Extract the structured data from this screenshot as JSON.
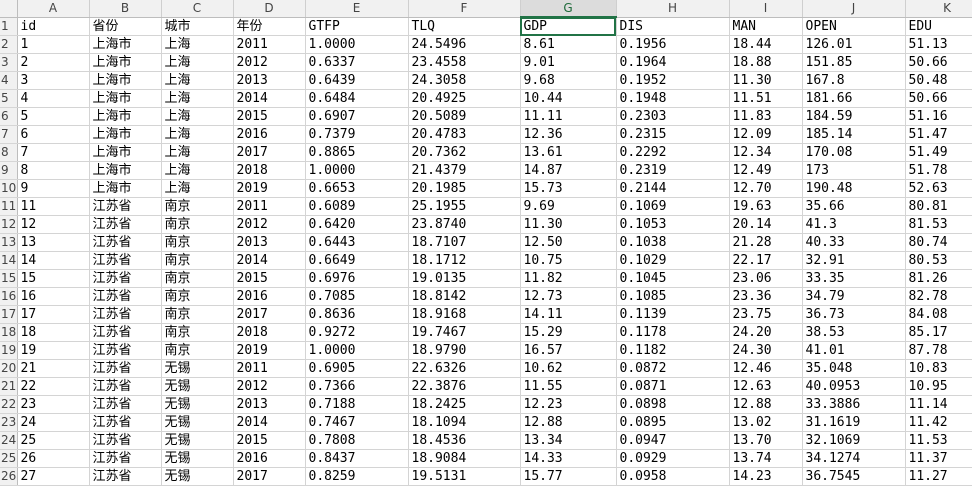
{
  "columns": [
    "A",
    "B",
    "C",
    "D",
    "E",
    "F",
    "G",
    "H",
    "I",
    "J",
    "K"
  ],
  "active_column": "G",
  "selected_cell": "G1",
  "rows": [
    {
      "n": "1",
      "cells": [
        "id",
        "省份",
        "城市",
        "年份",
        "GTFP",
        "TLQ",
        "GDP",
        "DIS",
        "MAN",
        "OPEN",
        "EDU"
      ]
    },
    {
      "n": "2",
      "cells": [
        "1",
        "上海市",
        "上海",
        "2011",
        "1.0000",
        "24.5496",
        "8.61",
        "0.1956",
        "18.44",
        "126.01",
        "51.13"
      ]
    },
    {
      "n": "3",
      "cells": [
        "2",
        "上海市",
        "上海",
        "2012",
        "0.6337",
        "23.4558",
        "9.01",
        "0.1964",
        "18.88",
        "151.85",
        "50.66"
      ]
    },
    {
      "n": "4",
      "cells": [
        "3",
        "上海市",
        "上海",
        "2013",
        "0.6439",
        "24.3058",
        "9.68",
        "0.1952",
        "11.30",
        "167.8",
        "50.48"
      ]
    },
    {
      "n": "5",
      "cells": [
        "4",
        "上海市",
        "上海",
        "2014",
        "0.6484",
        "20.4925",
        "10.44",
        "0.1948",
        "11.51",
        "181.66",
        "50.66"
      ]
    },
    {
      "n": "6",
      "cells": [
        "5",
        "上海市",
        "上海",
        "2015",
        "0.6907",
        "20.5089",
        "11.11",
        "0.2303",
        "11.83",
        "184.59",
        "51.16"
      ]
    },
    {
      "n": "7",
      "cells": [
        "6",
        "上海市",
        "上海",
        "2016",
        "0.7379",
        "20.4783",
        "12.36",
        "0.2315",
        "12.09",
        "185.14",
        "51.47"
      ]
    },
    {
      "n": "8",
      "cells": [
        "7",
        "上海市",
        "上海",
        "2017",
        "0.8865",
        "20.7362",
        "13.61",
        "0.2292",
        "12.34",
        "170.08",
        "51.49"
      ]
    },
    {
      "n": "9",
      "cells": [
        "8",
        "上海市",
        "上海",
        "2018",
        "1.0000",
        "21.4379",
        "14.87",
        "0.2319",
        "12.49",
        "173",
        "51.78"
      ]
    },
    {
      "n": "10",
      "cells": [
        "9",
        "上海市",
        "上海",
        "2019",
        "0.6653",
        "20.1985",
        "15.73",
        "0.2144",
        "12.70",
        "190.48",
        "52.63"
      ]
    },
    {
      "n": "11",
      "cells": [
        "11",
        "江苏省",
        "南京",
        "2011",
        "0.6089",
        "25.1955",
        "9.69",
        "0.1069",
        "19.63",
        "35.66",
        "80.81"
      ]
    },
    {
      "n": "12",
      "cells": [
        "12",
        "江苏省",
        "南京",
        "2012",
        "0.6420",
        "23.8740",
        "11.30",
        "0.1053",
        "20.14",
        "41.3",
        "81.53"
      ]
    },
    {
      "n": "13",
      "cells": [
        "13",
        "江苏省",
        "南京",
        "2013",
        "0.6443",
        "18.7107",
        "12.50",
        "0.1038",
        "21.28",
        "40.33",
        "80.74"
      ]
    },
    {
      "n": "14",
      "cells": [
        "14",
        "江苏省",
        "南京",
        "2014",
        "0.6649",
        "18.1712",
        "10.75",
        "0.1029",
        "22.17",
        "32.91",
        "80.53"
      ]
    },
    {
      "n": "15",
      "cells": [
        "15",
        "江苏省",
        "南京",
        "2015",
        "0.6976",
        "19.0135",
        "11.82",
        "0.1045",
        "23.06",
        "33.35",
        "81.26"
      ]
    },
    {
      "n": "16",
      "cells": [
        "16",
        "江苏省",
        "南京",
        "2016",
        "0.7085",
        "18.8142",
        "12.73",
        "0.1085",
        "23.36",
        "34.79",
        "82.78"
      ]
    },
    {
      "n": "17",
      "cells": [
        "17",
        "江苏省",
        "南京",
        "2017",
        "0.8636",
        "18.9168",
        "14.11",
        "0.1139",
        "23.75",
        "36.73",
        "84.08"
      ]
    },
    {
      "n": "18",
      "cells": [
        "18",
        "江苏省",
        "南京",
        "2018",
        "0.9272",
        "19.7467",
        "15.29",
        "0.1178",
        "24.20",
        "38.53",
        "85.17"
      ]
    },
    {
      "n": "19",
      "cells": [
        "19",
        "江苏省",
        "南京",
        "2019",
        "1.0000",
        "18.9790",
        "16.57",
        "0.1182",
        "24.30",
        "41.01",
        "87.78"
      ]
    },
    {
      "n": "20",
      "cells": [
        "21",
        "江苏省",
        "无锡",
        "2011",
        "0.6905",
        "22.6326",
        "10.62",
        "0.0872",
        "12.46",
        "35.048",
        "10.83"
      ]
    },
    {
      "n": "21",
      "cells": [
        "22",
        "江苏省",
        "无锡",
        "2012",
        "0.7366",
        "22.3876",
        "11.55",
        "0.0871",
        "12.63",
        "40.0953",
        "10.95"
      ]
    },
    {
      "n": "22",
      "cells": [
        "23",
        "江苏省",
        "无锡",
        "2013",
        "0.7188",
        "18.2425",
        "12.23",
        "0.0898",
        "12.88",
        "33.3886",
        "11.14"
      ]
    },
    {
      "n": "23",
      "cells": [
        "24",
        "江苏省",
        "无锡",
        "2014",
        "0.7467",
        "18.1094",
        "12.88",
        "0.0895",
        "13.02",
        "31.1619",
        "11.42"
      ]
    },
    {
      "n": "24",
      "cells": [
        "25",
        "江苏省",
        "无锡",
        "2015",
        "0.7808",
        "18.4536",
        "13.34",
        "0.0947",
        "13.70",
        "32.1069",
        "11.53"
      ]
    },
    {
      "n": "25",
      "cells": [
        "26",
        "江苏省",
        "无锡",
        "2016",
        "0.8437",
        "18.9084",
        "14.33",
        "0.0929",
        "13.74",
        "34.1274",
        "11.37"
      ]
    },
    {
      "n": "26",
      "cells": [
        "27",
        "江苏省",
        "无锡",
        "2017",
        "0.8259",
        "19.5131",
        "15.77",
        "0.0958",
        "14.23",
        "36.7545",
        "11.27"
      ]
    }
  ]
}
